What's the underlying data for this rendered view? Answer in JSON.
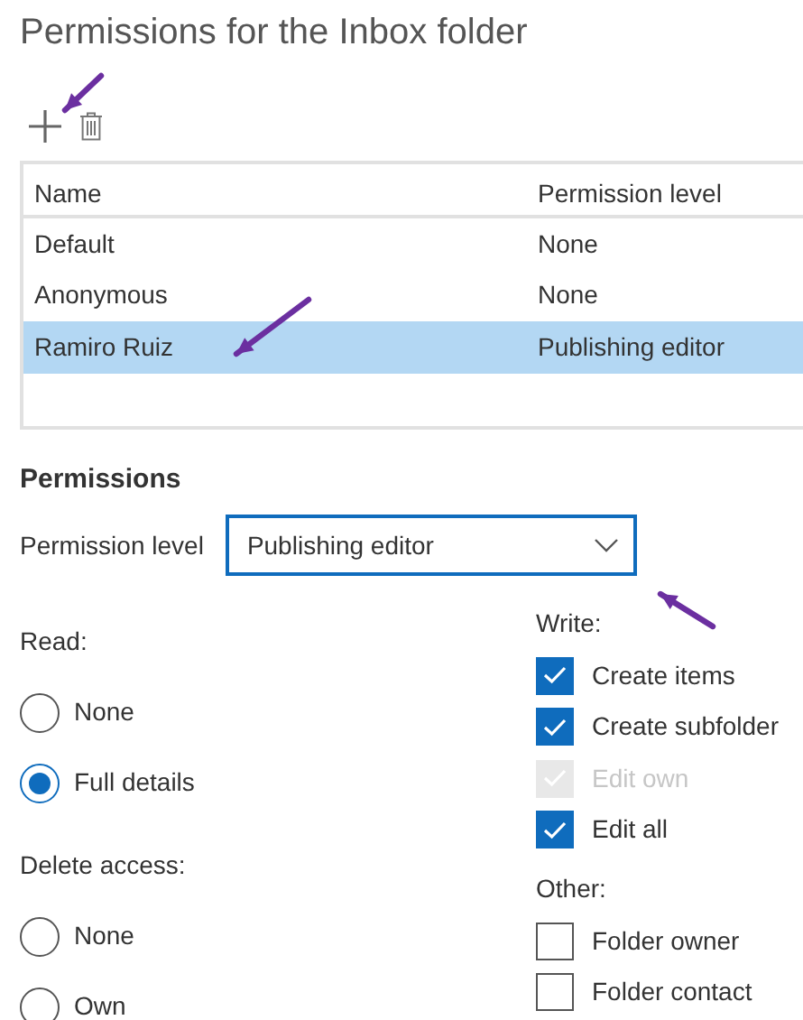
{
  "title": "Permissions for the Inbox folder",
  "table": {
    "columns": [
      "Name",
      "Permission level"
    ],
    "rows": [
      {
        "name": "Default",
        "permission_level": "None",
        "selected": false
      },
      {
        "name": "Anonymous",
        "permission_level": "None",
        "selected": false
      },
      {
        "name": "Ramiro Ruiz",
        "permission_level": "Publishing editor",
        "selected": true
      }
    ]
  },
  "permissions": {
    "heading": "Permissions",
    "permission_level": {
      "label": "Permission level",
      "value": "Publishing editor"
    },
    "read": {
      "label": "Read:",
      "options": [
        {
          "label": "None",
          "selected": false
        },
        {
          "label": "Full details",
          "selected": true
        }
      ]
    },
    "delete_access": {
      "label": "Delete access:",
      "options": [
        {
          "label": "None",
          "selected": false
        },
        {
          "label": "Own",
          "selected": false
        }
      ]
    },
    "write": {
      "label": "Write:",
      "options": [
        {
          "label": "Create items",
          "checked": true,
          "disabled": false
        },
        {
          "label": "Create subfolder",
          "checked": true,
          "disabled": false
        },
        {
          "label": "Edit own",
          "checked": true,
          "disabled": true
        },
        {
          "label": "Edit all",
          "checked": true,
          "disabled": false
        }
      ]
    },
    "other": {
      "label": "Other:",
      "options": [
        {
          "label": "Folder owner",
          "checked": false
        },
        {
          "label": "Folder contact",
          "checked": false
        }
      ]
    }
  }
}
